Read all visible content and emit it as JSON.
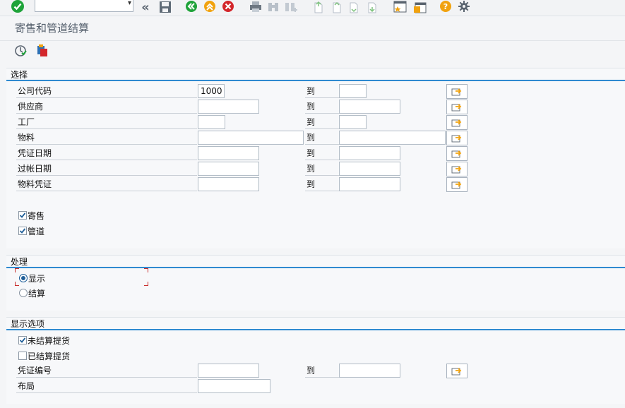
{
  "toolbar": {
    "command_field_value": "",
    "icons": [
      "enter-icon",
      "back-arrows-icon",
      "save-icon",
      "back-icon",
      "exit-icon",
      "cancel-icon",
      "print-icon",
      "find-icon",
      "find-next-icon",
      "first-page-icon",
      "prev-page-icon",
      "next-page-icon",
      "last-page-icon",
      "create-session-icon",
      "shortcut-icon",
      "help-icon",
      "settings-gear-icon"
    ]
  },
  "title": "寄售和管道结算",
  "app_toolbar": {
    "icons": [
      "execute-icon",
      "get-variant-icon"
    ]
  },
  "sections": {
    "selection": {
      "title": "选择",
      "to_label": "到",
      "rows": [
        {
          "label": "公司代码",
          "from": "1000",
          "to": ""
        },
        {
          "label": "供应商",
          "from": "",
          "to": ""
        },
        {
          "label": "工厂",
          "from": "",
          "to": ""
        },
        {
          "label": "物料",
          "from": "",
          "to": ""
        },
        {
          "label": "凭证日期",
          "from": "",
          "to": ""
        },
        {
          "label": "过帐日期",
          "from": "",
          "to": ""
        },
        {
          "label": "物料凭证",
          "from": "",
          "to": ""
        }
      ],
      "checkboxes": [
        {
          "label": "寄售",
          "checked": true
        },
        {
          "label": "管道",
          "checked": true
        }
      ]
    },
    "processing": {
      "title": "处理",
      "radios": [
        {
          "label": "显示",
          "selected": true
        },
        {
          "label": "结算",
          "selected": false
        }
      ]
    },
    "display_options": {
      "title": "显示选项",
      "checkboxes": [
        {
          "label": "未结算提货",
          "checked": true
        },
        {
          "label": "已结算提货",
          "checked": false
        }
      ],
      "doc_number_label": "凭证编号",
      "doc_number_from": "",
      "doc_number_to": "",
      "to_label": "到",
      "layout_label": "布局",
      "layout_value": ""
    }
  },
  "colors": {
    "accent": "#2f8ad0",
    "green": "#1fa33a",
    "red": "#d3262b",
    "orange": "#f1a20e"
  }
}
